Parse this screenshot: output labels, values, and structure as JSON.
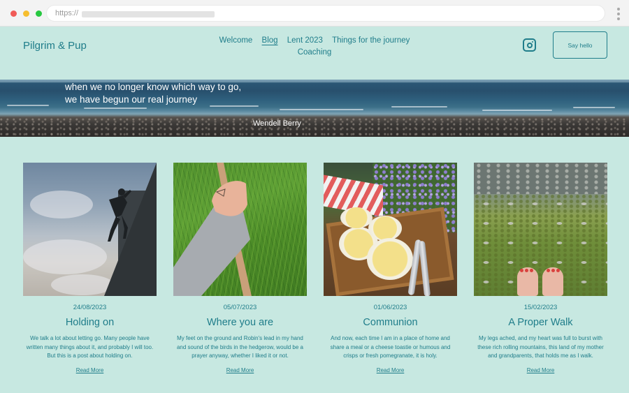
{
  "browser": {
    "url_prefix": "https://"
  },
  "header": {
    "brand": "Pilgrim & Pup",
    "nav": [
      {
        "label": "Welcome",
        "active": false
      },
      {
        "label": "Blog",
        "active": true
      },
      {
        "label": "Lent 2023",
        "active": false
      },
      {
        "label": "Things for the journey",
        "active": false
      },
      {
        "label": "Coaching",
        "active": false
      }
    ],
    "instagram_icon": "instagram-icon",
    "cta_label": "Say hello"
  },
  "hero": {
    "quote_line1": "when we no longer know which way to go,",
    "quote_line2": "we have begun our real journey",
    "author": "Wendell Berry"
  },
  "posts": [
    {
      "date": "24/08/2023",
      "title": "Holding on",
      "excerpt": "We talk a lot about letting go. Many people have written many things about it, and probably I will too. But this is a post about holding on.",
      "read_more": "Read More"
    },
    {
      "date": "05/07/2023",
      "title": "Where you are",
      "excerpt": "My feet on the ground and Robin's lead in my hand and sound of the birds in the hedgerow, would be a prayer anyway, whether I liked it or not.",
      "read_more": "Read More"
    },
    {
      "date": "01/06/2023",
      "title": "Communion",
      "excerpt": "And now, each time I am in a place of home and share a meal or a cheese toastie or humous and crisps or fresh pomegranate, it is holy.",
      "read_more": "Read More"
    },
    {
      "date": "15/02/2023",
      "title": "A Proper Walk",
      "excerpt": "My legs ached, and my heart was full to burst with these rich rolling mountains, this land of my mother and grandparents, that holds me as I walk.",
      "read_more": "Read More"
    }
  ],
  "colors": {
    "background": "#c7e8e1",
    "accent": "#1f7d8a"
  }
}
